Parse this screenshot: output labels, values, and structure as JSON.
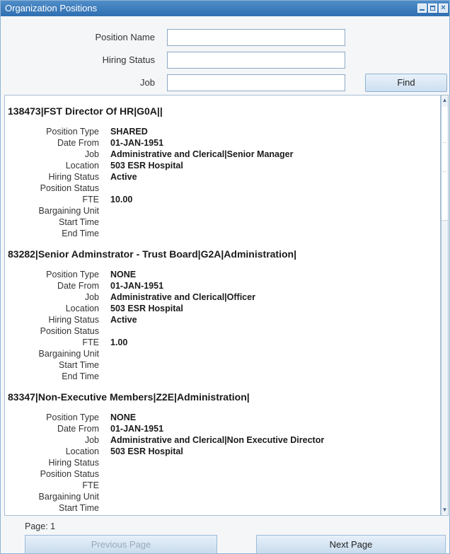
{
  "window": {
    "title": "Organization Positions"
  },
  "search": {
    "position_name_label": "Position Name",
    "position_name_value": "",
    "hiring_status_label": "Hiring Status",
    "hiring_status_value": "",
    "job_label": "Job",
    "job_value": "",
    "find_label": "Find"
  },
  "field_labels": [
    "Position Type",
    "Date From",
    "Job",
    "Location",
    "Hiring Status",
    "Position Status",
    "FTE",
    "Bargaining Unit",
    "Start Time",
    "End Time"
  ],
  "records": [
    {
      "title": "138473|FST Director Of HR|G0A||",
      "values": [
        "SHARED",
        "01-JAN-1951",
        "Administrative and Clerical|Senior Manager",
        "503 ESR Hospital",
        "Active",
        "",
        "10.00",
        "",
        "",
        ""
      ]
    },
    {
      "title": "83282|Senior Adminstrator - Trust Board|G2A|Administration|",
      "values": [
        "NONE",
        "01-JAN-1951",
        "Administrative and Clerical|Officer",
        "503 ESR Hospital",
        "Active",
        "",
        "1.00",
        "",
        "",
        ""
      ]
    },
    {
      "title": "83347|Non-Executive Members|Z2E|Administration|",
      "values": [
        "NONE",
        "01-JAN-1951",
        "Administrative and Clerical|Non Executive Director",
        "503 ESR Hospital",
        "",
        "",
        "",
        "",
        "",
        ""
      ]
    }
  ],
  "pager": {
    "page_label": "Page: 1",
    "previous_label": "Previous Page",
    "next_label": "Next Page"
  }
}
